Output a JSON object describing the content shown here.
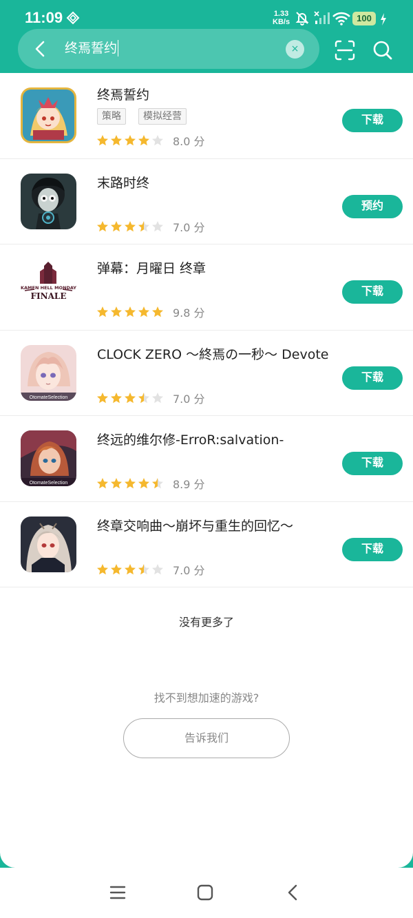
{
  "status": {
    "time": "11:09",
    "speed_value": "1.33",
    "speed_unit": "KB/s",
    "battery": "100"
  },
  "search": {
    "query": "终焉誓约",
    "clear_symbol": "×"
  },
  "games": [
    {
      "title": "终焉誓约",
      "tags": [
        "策略",
        "模拟经营"
      ],
      "rating": 4,
      "score": "8.0 分",
      "action": "下载",
      "icon": "game-icon-shuuen-seiyaku"
    },
    {
      "title": "末路时终",
      "tags": [],
      "rating": 3.5,
      "score": "7.0 分",
      "action": "预约",
      "icon": "game-icon-molu-shizhong"
    },
    {
      "title": "弹幕：月曜日 终章",
      "tags": [],
      "rating": 5,
      "score": "9.8 分",
      "action": "下载",
      "icon": "game-icon-danmaku-finale"
    },
    {
      "title": "CLOCK ZERO ～終焉の一秒～ Devote",
      "tags": [],
      "rating": 3.5,
      "score": "7.0 分",
      "action": "下载",
      "icon": "game-icon-clock-zero"
    },
    {
      "title": "终远的维尔修-ErroR:salvation-",
      "tags": [],
      "rating": 4.5,
      "score": "8.9 分",
      "action": "下载",
      "icon": "game-icon-error-salvation"
    },
    {
      "title": "终章交响曲～崩坏与重生的回忆～",
      "tags": [],
      "rating": 3.5,
      "score": "7.0 分",
      "action": "下载",
      "icon": "game-icon-symphony"
    }
  ],
  "icon_captions": {
    "finale_top": "KAMEN HELL MONDAY",
    "finale_bottom": "FINALE",
    "otomate": "OtomateSelection"
  },
  "footer": {
    "no_more": "没有更多了",
    "prompt": "找不到想加速的游戏?",
    "tell_us": "告诉我们"
  },
  "colors": {
    "accent": "#1ab69a",
    "star_on": "#f5b82e",
    "star_off": "#e2e2e2"
  }
}
